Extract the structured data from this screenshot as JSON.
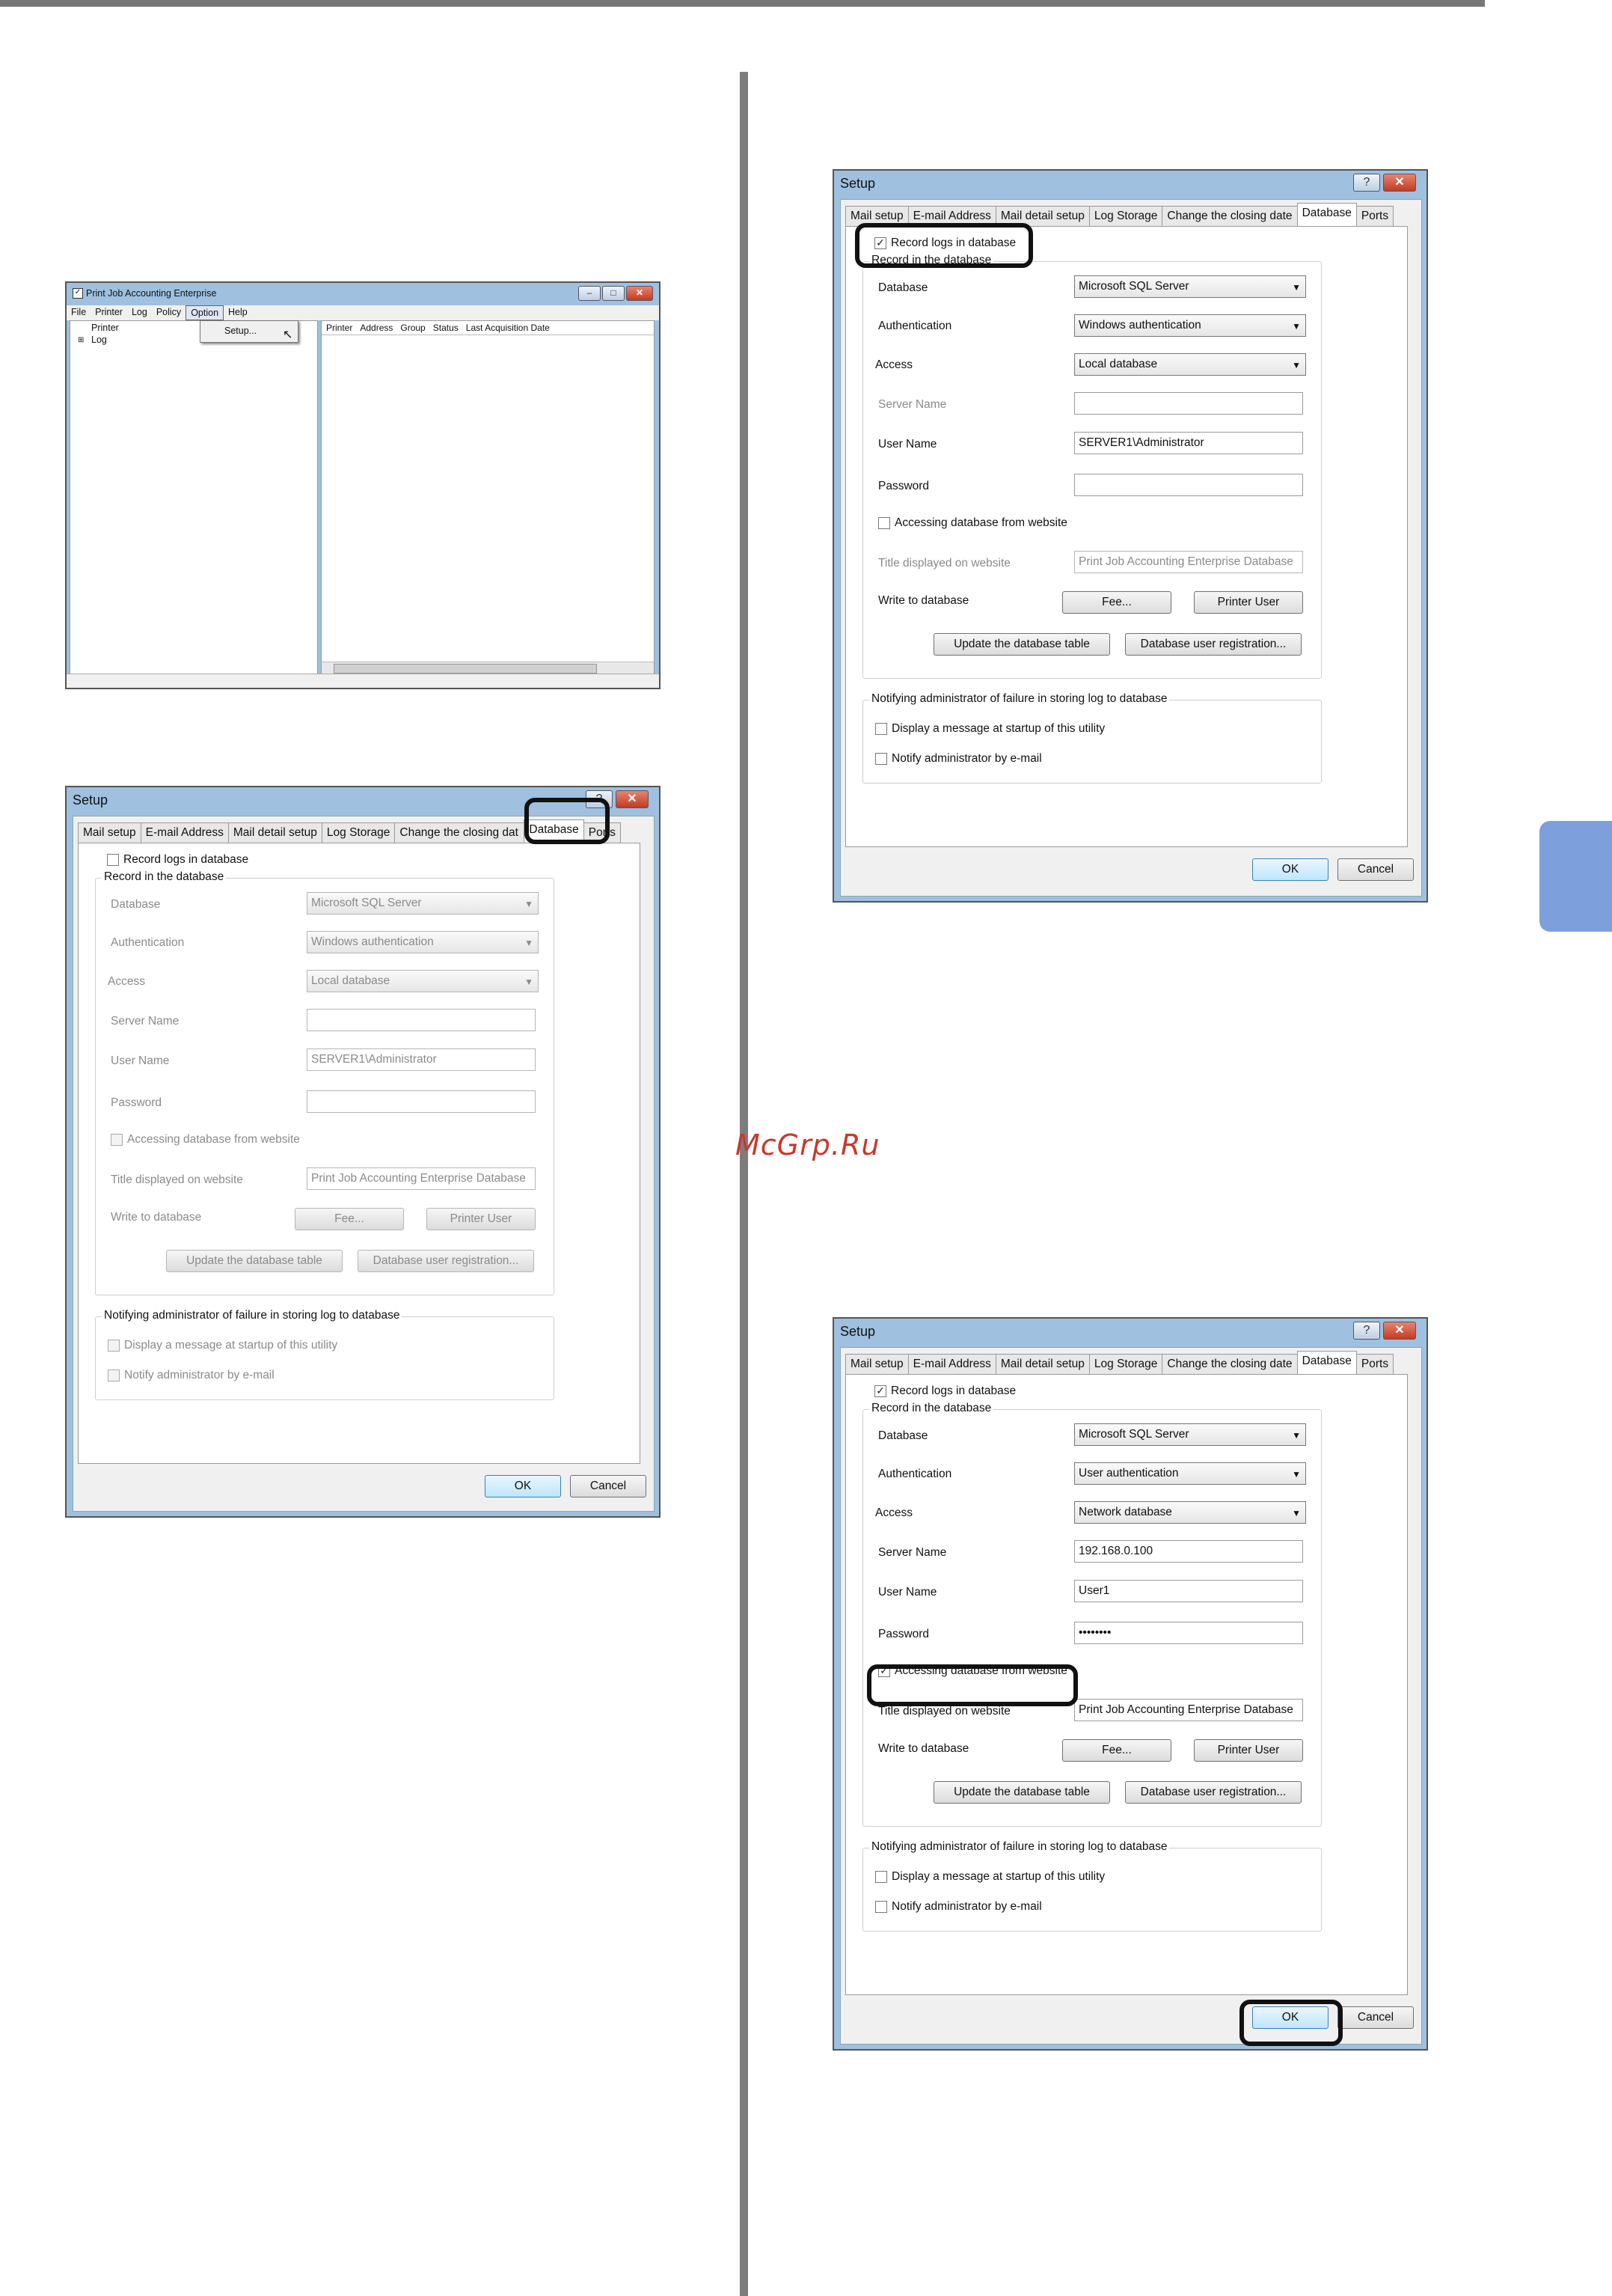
{
  "watermark": "McGrp.Ru",
  "main_window": {
    "title": "Print Job Accounting Enterprise",
    "menu": [
      "File",
      "Printer",
      "Log",
      "Policy",
      "Option",
      "Help"
    ],
    "dropdown_item": "Setup...",
    "tree": [
      "Printer",
      "Log"
    ],
    "columns": [
      "Printer",
      "Address",
      "Group",
      "Status",
      "Last Acquisition Date"
    ]
  },
  "tabs": [
    "Mail setup",
    "E-mail Address",
    "Mail detail setup",
    "Log Storage",
    "Change the closing date",
    "Database",
    "Ports"
  ],
  "tabs_truncated": [
    "Mail setup",
    "E-mail Address",
    "Mail detail setup",
    "Log Storage",
    "Change the closing dat",
    "Database",
    "Ports"
  ],
  "labels": {
    "dialog_title": "Setup",
    "record_logs": "Record logs in database",
    "record_group": "Record in the database",
    "database": "Database",
    "authentication": "Authentication",
    "access": "Access",
    "server_name": "Server Name",
    "user_name": "User Name",
    "password": "Password",
    "accessing_web": "Accessing database from website",
    "title_web": "Title displayed on website",
    "write_db": "Write to database",
    "fee": "Fee...",
    "printer_user": "Printer User",
    "update_table": "Update the database table",
    "db_user_reg": "Database user registration...",
    "notify_group": "Notifying administrator of failure in storing log to database",
    "display_msg": "Display a message at startup of this utility",
    "notify_email": "Notify administrator by e-mail",
    "ok": "OK",
    "cancel": "Cancel",
    "help_btn": "?",
    "close_btn": "X"
  },
  "dialog1": {
    "record_checked": "",
    "database": "Microsoft SQL Server",
    "authentication": "Windows authentication",
    "access": "Local database",
    "server_name": "",
    "user_name": "SERVER1\\Administrator",
    "password": "",
    "web_title": "Print Job Accounting Enterprise Database"
  },
  "dialog2": {
    "record_checked": "✓",
    "database": "Microsoft SQL Server",
    "authentication": "Windows authentication",
    "access": "Local database",
    "server_name": "",
    "user_name": "SERVER1\\Administrator",
    "password": "",
    "web_title": "Print Job Accounting Enterprise Database"
  },
  "dialog3": {
    "record_checked": "✓",
    "web_checked": "✓",
    "database": "Microsoft SQL Server",
    "authentication": "User authentication",
    "access": "Network database",
    "server_name": "192.168.0.100",
    "user_name": "User1",
    "password": "••••••••",
    "web_title": "Print Job Accounting Enterprise Database"
  }
}
